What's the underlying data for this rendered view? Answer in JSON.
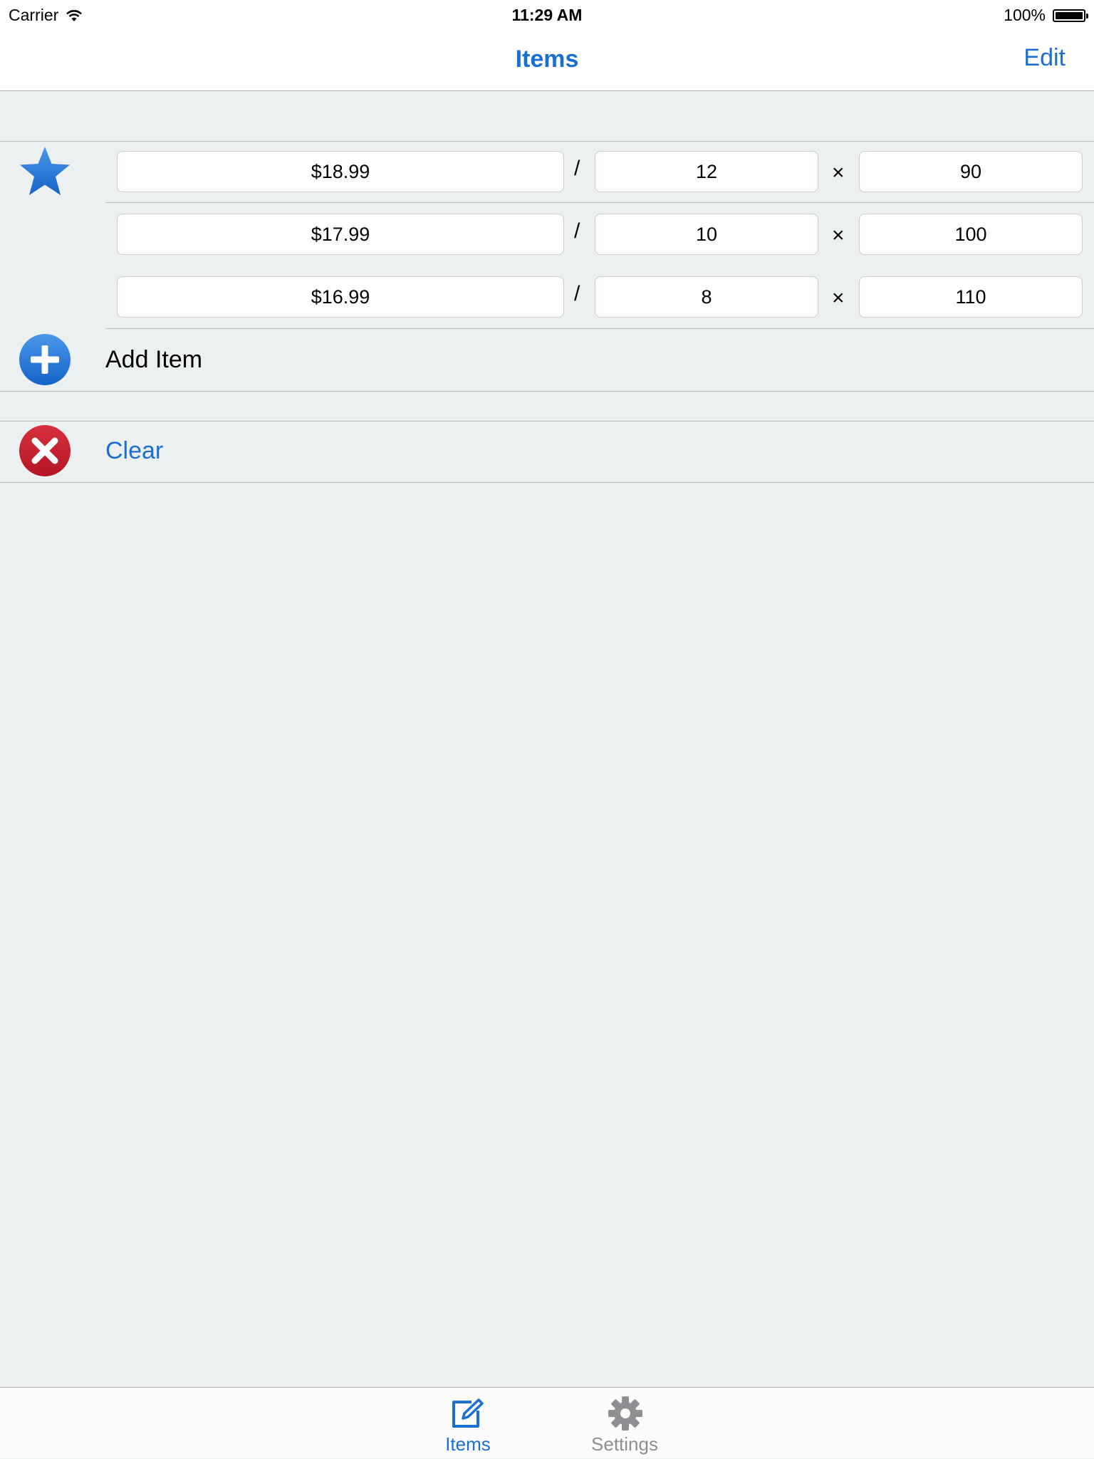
{
  "status_bar": {
    "carrier": "Carrier",
    "wifi_icon": "wifi-icon",
    "time": "11:29 AM",
    "battery": "100%",
    "battery_icon": "battery-icon"
  },
  "nav": {
    "title": "Items",
    "edit_label": "Edit"
  },
  "item_group": {
    "icon": "star-icon",
    "rows": [
      {
        "price": "$18.99",
        "separator1": "/",
        "quantity": "12",
        "separator2": "×",
        "size": "90"
      },
      {
        "price": "$17.99",
        "separator1": "/",
        "quantity": "10",
        "separator2": "×",
        "size": "100"
      },
      {
        "price": "$16.99",
        "separator1": "/",
        "quantity": "8",
        "separator2": "×",
        "size": "110"
      }
    ]
  },
  "add_item": {
    "icon": "plus-circle-icon",
    "label": "Add Item"
  },
  "clear": {
    "icon": "x-circle-icon",
    "label": "Clear"
  },
  "tab_bar": {
    "tabs": [
      {
        "label": "Items",
        "icon": "compose-icon",
        "selected": true
      },
      {
        "label": "Settings",
        "icon": "gear-icon",
        "selected": false
      }
    ]
  },
  "colors": {
    "accent": "#1a6fd1",
    "background": "#edf0f1",
    "clear_red": "#c8202f",
    "inactive_tab": "#8e8e93"
  }
}
